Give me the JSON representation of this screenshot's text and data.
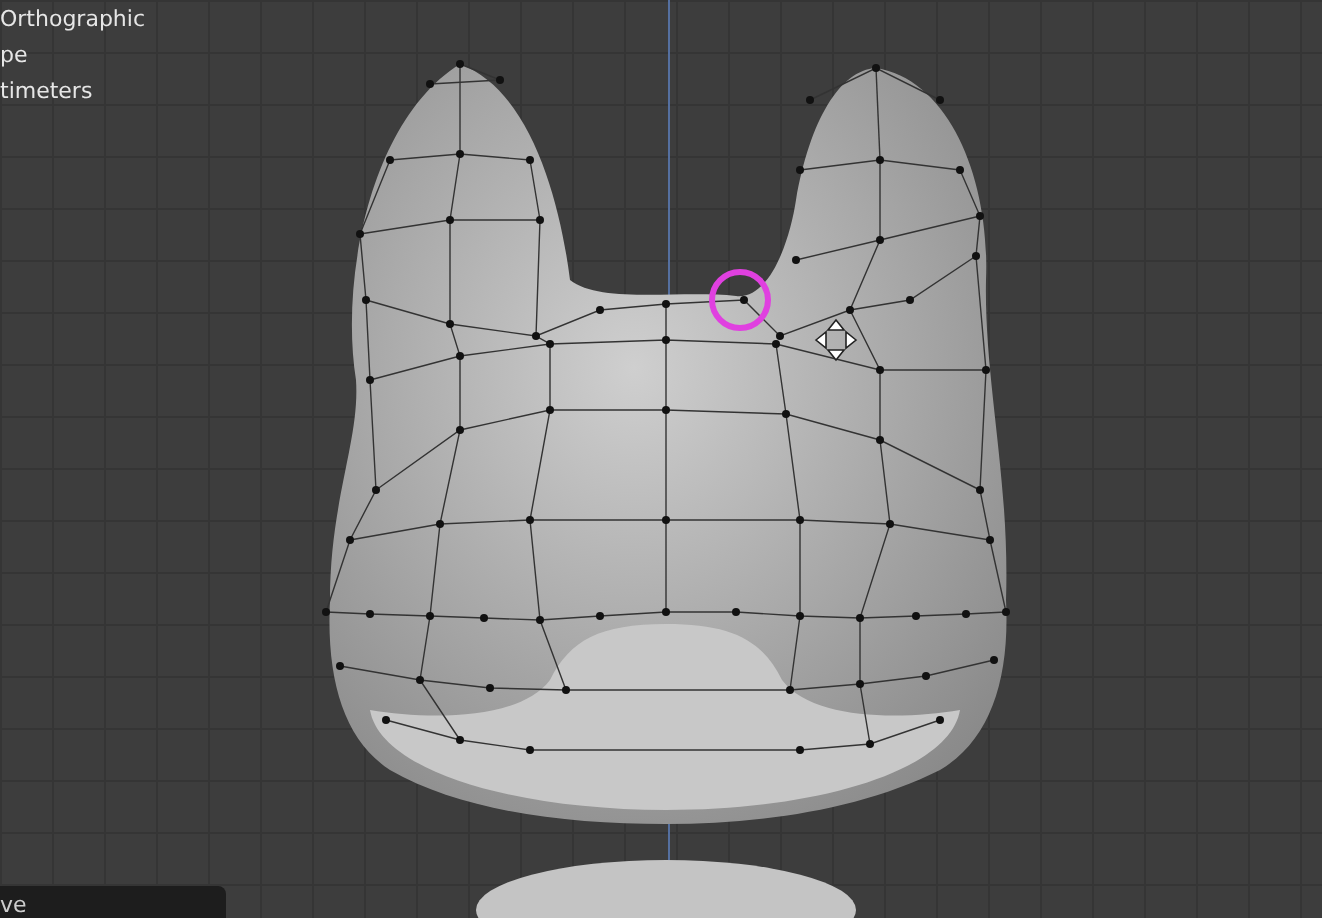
{
  "viewport": {
    "overlay_lines": [
      "Orthographic",
      "pe",
      "timeters"
    ]
  },
  "operator_panel": {
    "title": "ve"
  }
}
